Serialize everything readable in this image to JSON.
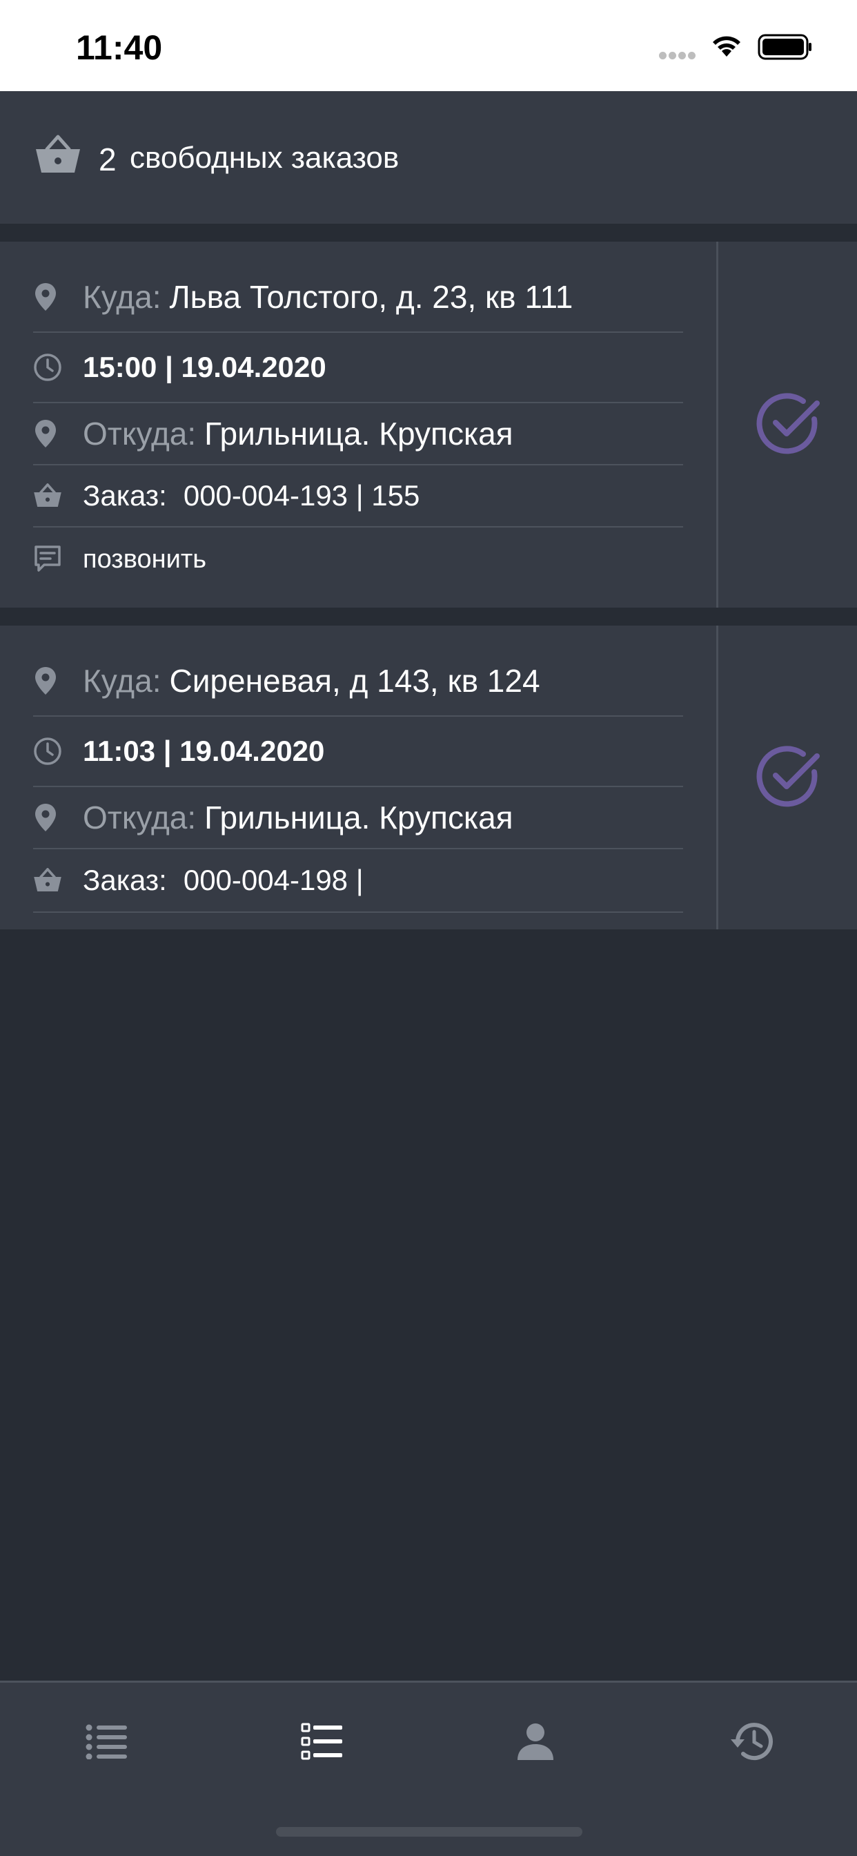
{
  "status_bar": {
    "time": "11:40"
  },
  "header": {
    "count": "2",
    "label": "свободных заказов",
    "icon": "basket-icon"
  },
  "orders": [
    {
      "to_label": "Куда:",
      "to_value": "Льва Толстого, д. 23, кв 111",
      "time": "15:00 | 19.04.2020",
      "from_label": "Откуда:",
      "from_value": "Грильница. Крупская",
      "order_label": "Заказ:",
      "order_value": "000-004-193 | 155",
      "call_label": "позвонить"
    },
    {
      "to_label": "Куда:",
      "to_value": "Сиреневая, д 143, кв 124",
      "time": "11:03 | 19.04.2020",
      "from_label": "Откуда:",
      "from_value": "Грильница. Крупская",
      "order_label": "Заказ:",
      "order_value": "000-004-198 |"
    }
  ],
  "nav": [
    {
      "name": "list-icon",
      "active": false
    },
    {
      "name": "checklist-icon",
      "active": true
    },
    {
      "name": "profile-icon",
      "active": false
    },
    {
      "name": "history-icon",
      "active": false
    }
  ],
  "colors": {
    "background": "#272c34",
    "card": "#363b45",
    "accent": "#6b5b9e",
    "muted": "#9aa0a8",
    "icon": "#8a909a"
  }
}
